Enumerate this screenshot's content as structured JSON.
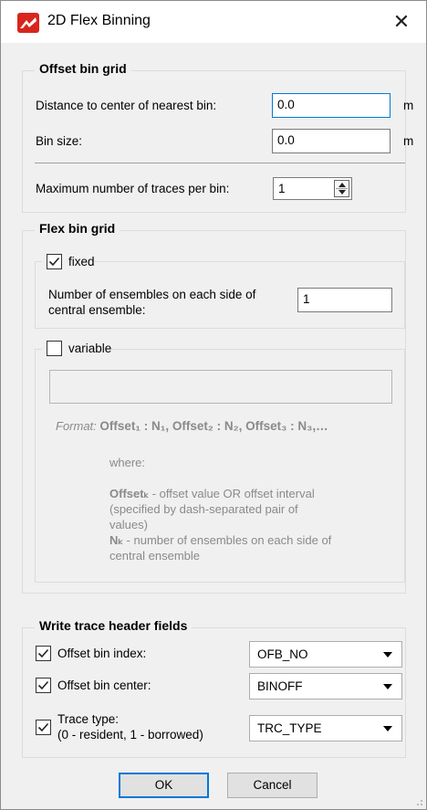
{
  "window": {
    "title": "2D Flex Binning",
    "close_symbol": "✕",
    "accent_color": "#0078d7",
    "icon": "app-logo-icon"
  },
  "offset_bin_grid": {
    "title": "Offset bin grid",
    "distance_label": "Distance to center of nearest bin:",
    "distance_value": "0.0",
    "distance_unit": "m",
    "bin_size_label": "Bin size:",
    "bin_size_value": "0.0",
    "bin_size_unit": "m",
    "max_traces_label": "Maximum number of traces per bin:",
    "max_traces_value": "1"
  },
  "flex_bin_grid": {
    "title": "Flex bin grid",
    "fixed_label": "fixed",
    "fixed_checked": true,
    "ensembles_label_line1": "Number of ensembles on each side of",
    "ensembles_label_line2": "central ensemble:",
    "ensembles_value": "1",
    "variable_label": "variable",
    "variable_checked": false,
    "variable_value": "",
    "format_label": "Format:",
    "format_expr": "Offset₁ : N₁, Offset₂ : N₂, Offset₃ : N₃,…",
    "where_label": "where:",
    "offsetk_term": "Offsetₖ",
    "offsetk_desc_line1": " - offset value OR offset interval",
    "offsetk_desc_line2": "(specified by dash-separated pair of",
    "offsetk_desc_line3": "values)",
    "nk_term": "Nₖ",
    "nk_desc_line1": " - number of ensembles on each side of",
    "nk_desc_line2": "central ensemble"
  },
  "write_trace_header": {
    "title": "Write trace header fields",
    "rows": [
      {
        "label": "Offset bin index:",
        "checked": true,
        "value": "OFB_NO"
      },
      {
        "label": "Offset bin center:",
        "checked": true,
        "value": "BINOFF"
      },
      {
        "label_line1": "Trace type:",
        "label_line2": "(0 - resident, 1 - borrowed)",
        "checked": true,
        "value": "TRC_TYPE"
      }
    ]
  },
  "buttons": {
    "ok": "OK",
    "cancel": "Cancel"
  }
}
